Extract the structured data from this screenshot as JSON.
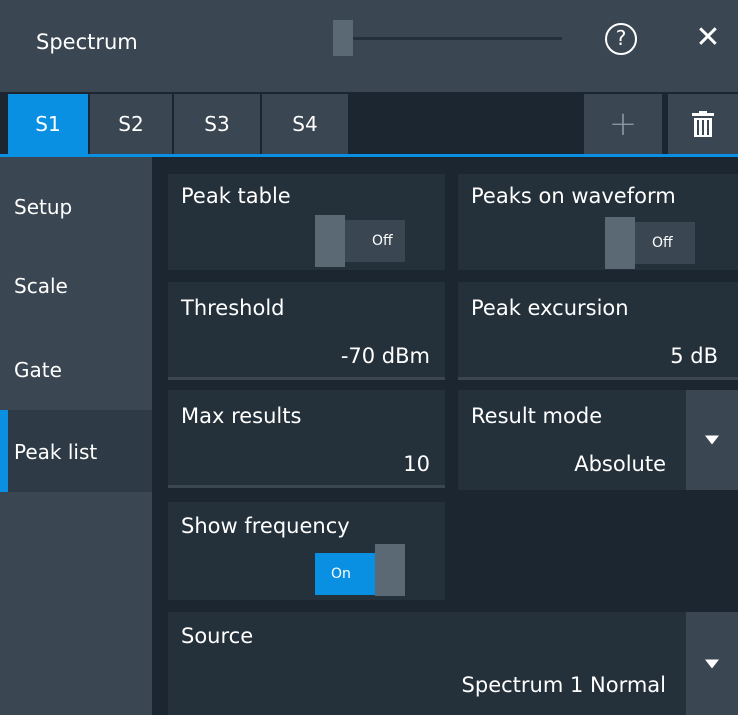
{
  "window": {
    "title": "Spectrum",
    "help_glyph": "?",
    "close_glyph": "✕"
  },
  "tabs": [
    {
      "label": "S1",
      "active": true
    },
    {
      "label": "S2",
      "active": false
    },
    {
      "label": "S3",
      "active": false
    },
    {
      "label": "S4",
      "active": false
    }
  ],
  "toolbar": {
    "add_glyph": "+",
    "delete_icon": "trash-icon"
  },
  "sidebar": {
    "items": [
      {
        "label": "Setup",
        "active": false
      },
      {
        "label": "Scale",
        "active": false
      },
      {
        "label": "Gate",
        "active": false
      },
      {
        "label": "Peak list",
        "active": true
      }
    ]
  },
  "peak_list": {
    "peak_table": {
      "label": "Peak table",
      "state": "Off"
    },
    "peaks_on_waveform": {
      "label": "Peaks on waveform",
      "state": "Off"
    },
    "threshold": {
      "label": "Threshold",
      "value": "-70 dBm"
    },
    "peak_excursion": {
      "label": "Peak excursion",
      "value": "5 dB"
    },
    "max_results": {
      "label": "Max results",
      "value": "10"
    },
    "result_mode": {
      "label": "Result mode",
      "value": "Absolute"
    },
    "show_frequency": {
      "label": "Show frequency",
      "state": "On"
    },
    "source": {
      "label": "Source",
      "value": "Spectrum 1 Normal"
    }
  },
  "colors": {
    "accent": "#0a90e3",
    "background": "#1b2630",
    "panel": "#24303a",
    "bar": "#3a4651"
  }
}
